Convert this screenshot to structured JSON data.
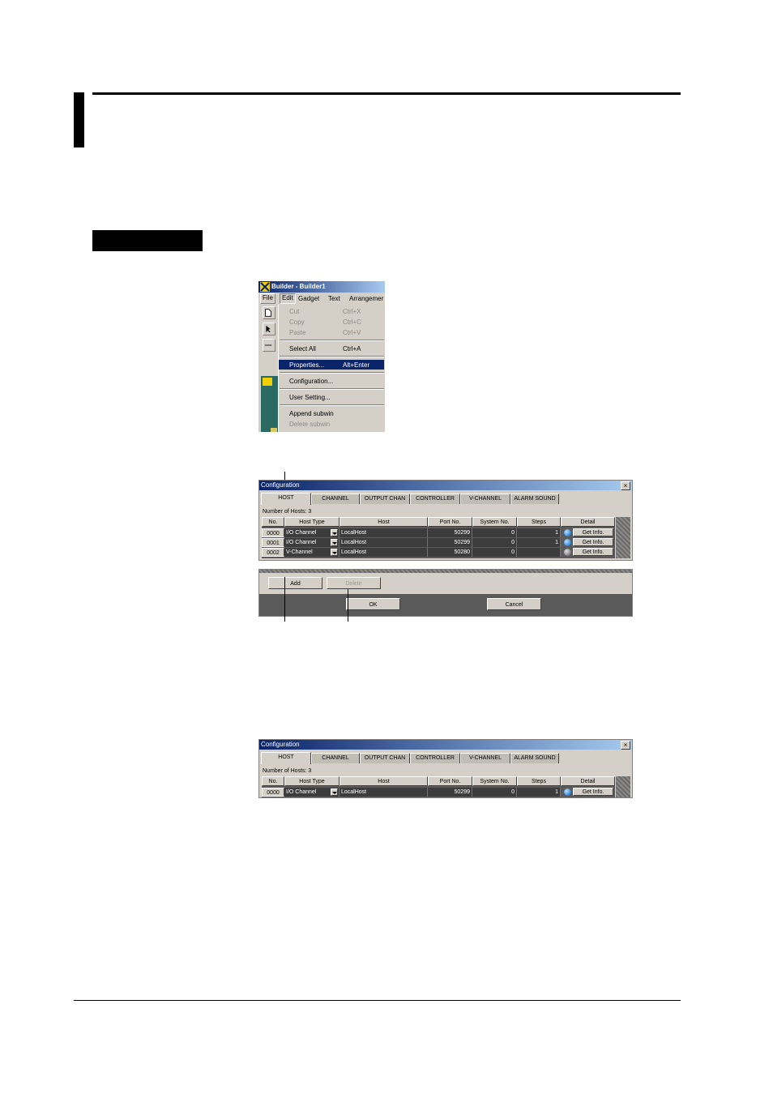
{
  "builder": {
    "title": "Builder - Builder1",
    "menubar": [
      "File",
      "Edit",
      "Gadget",
      "Text",
      "Arrangemer"
    ],
    "edit_menu": [
      {
        "label": "Cut",
        "shortcut": "Ctrl+X",
        "enabled": false
      },
      {
        "label": "Copy",
        "shortcut": "Ctrl+C",
        "enabled": false
      },
      {
        "label": "Paste",
        "shortcut": "Ctrl+V",
        "enabled": false
      },
      {
        "label": "Select All",
        "shortcut": "Ctrl+A",
        "enabled": true
      },
      {
        "label": "Properties...",
        "shortcut": "Alt+Enter",
        "enabled": true,
        "selected": true
      },
      {
        "label": "Configuration...",
        "shortcut": "",
        "enabled": true
      },
      {
        "label": "User Setting...",
        "shortcut": "",
        "enabled": true
      },
      {
        "label": "Append subwin",
        "shortcut": "",
        "enabled": true
      },
      {
        "label": "Delete subwin",
        "shortcut": "",
        "enabled": false
      }
    ]
  },
  "config1": {
    "title": "Configuration",
    "close": "×",
    "tabs": [
      "HOST",
      "CHANNEL",
      "OUTPUT CHAN",
      "CONTROLLER",
      "V-CHANNEL",
      "ALARM SOUND"
    ],
    "hosts_count": "Number of Hosts: 3",
    "columns": [
      "No.",
      "Host Type",
      "Host",
      "Port No.",
      "System No.",
      "Steps",
      "Detail"
    ],
    "rows": [
      {
        "no": "0000",
        "host_type": "I/O Channel",
        "host": "LocalHost",
        "port": "50299",
        "system": "0",
        "steps": "1",
        "led": "blue",
        "detail": "Get Info."
      },
      {
        "no": "0001",
        "host_type": "I/O Channel",
        "host": "LocalHost",
        "port": "50299",
        "system": "0",
        "steps": "1",
        "led": "blue",
        "detail": "Get Info."
      },
      {
        "no": "0002",
        "host_type": "V-Channel",
        "host": "LocalHost",
        "port": "50280",
        "system": "0",
        "steps": "",
        "led": "gray",
        "detail": "Get Info."
      }
    ],
    "add_label": "Add",
    "delete_label": "Delete",
    "ok_label": "OK",
    "cancel_label": "Cancel"
  },
  "config2": {
    "title": "Configuration",
    "close": "×",
    "tabs": [
      "HOST",
      "CHANNEL",
      "OUTPUT CHAN",
      "CONTROLLER",
      "V-CHANNEL",
      "ALARM SOUND"
    ],
    "hosts_count": "Number of Hosts: 3",
    "columns": [
      "No.",
      "Host Type",
      "Host",
      "Port No.",
      "System No.",
      "Steps",
      "Detail"
    ],
    "rows": [
      {
        "no": "0000",
        "host_type": "I/O Channel",
        "host": "LocalHost",
        "port": "50299",
        "system": "0",
        "steps": "1",
        "led": "blue",
        "detail": "Get Info."
      }
    ]
  },
  "colors": {
    "led_blue": "#3d8fe0",
    "led_gray": "#8a8a8a",
    "title_start": "#0a246a",
    "title_end": "#a6caf0"
  }
}
